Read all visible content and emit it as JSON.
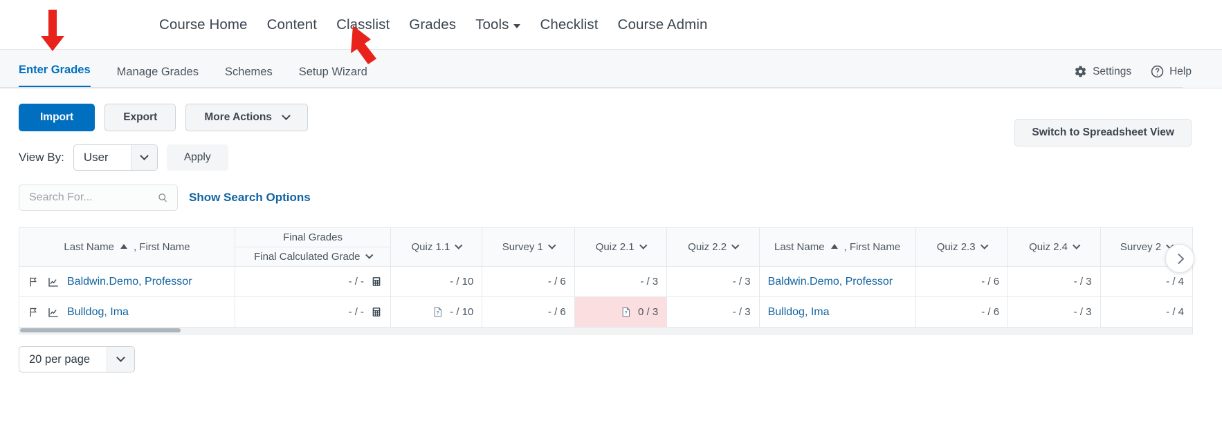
{
  "topnav": {
    "items": [
      {
        "label": "Course Home",
        "caret": false
      },
      {
        "label": "Content",
        "caret": false
      },
      {
        "label": "Classlist",
        "caret": false
      },
      {
        "label": "Grades",
        "caret": false
      },
      {
        "label": "Tools",
        "caret": true
      },
      {
        "label": "Checklist",
        "caret": false
      },
      {
        "label": "Course Admin",
        "caret": false
      }
    ]
  },
  "tabbar": {
    "tabs": [
      {
        "label": "Enter Grades",
        "active": true
      },
      {
        "label": "Manage Grades",
        "active": false
      },
      {
        "label": "Schemes",
        "active": false
      },
      {
        "label": "Setup Wizard",
        "active": false
      }
    ],
    "settings_label": "Settings",
    "help_label": "Help"
  },
  "toolbar": {
    "import_label": "Import",
    "export_label": "Export",
    "more_actions_label": "More Actions",
    "switch_view_label": "Switch to Spreadsheet View"
  },
  "viewby": {
    "label": "View By:",
    "value": "User",
    "apply_label": "Apply"
  },
  "search": {
    "placeholder": "Search For...",
    "value": "",
    "show_options_label": "Show Search Options"
  },
  "grid": {
    "group_header": "Final Grades",
    "columns": [
      {
        "key": "name1",
        "label": "Last Name",
        "suffix": ", First Name",
        "sort": true,
        "menu": false
      },
      {
        "key": "fcg",
        "label": "Final Calculated Grade",
        "suffix": "",
        "sort": false,
        "menu": true
      },
      {
        "key": "q11",
        "label": "Quiz 1.1",
        "suffix": "",
        "sort": false,
        "menu": true
      },
      {
        "key": "s1",
        "label": "Survey 1",
        "suffix": "",
        "sort": false,
        "menu": true
      },
      {
        "key": "q21",
        "label": "Quiz 2.1",
        "suffix": "",
        "sort": false,
        "menu": true
      },
      {
        "key": "q22",
        "label": "Quiz 2.2",
        "suffix": "",
        "sort": false,
        "menu": true
      },
      {
        "key": "name2",
        "label": "Last Name",
        "suffix": ", First Name",
        "sort": true,
        "menu": false
      },
      {
        "key": "q23",
        "label": "Quiz 2.3",
        "suffix": "",
        "sort": false,
        "menu": true
      },
      {
        "key": "q24",
        "label": "Quiz 2.4",
        "suffix": "",
        "sort": false,
        "menu": true
      },
      {
        "key": "s2",
        "label": "Survey 2",
        "suffix": "",
        "sort": false,
        "menu": true
      }
    ],
    "rows": [
      {
        "name": "Baldwin.Demo, Professor",
        "fcg": "- / -",
        "q11": "- / 10",
        "q11_icon": false,
        "s1": "- / 6",
        "q21": "- / 3",
        "q21_icon": false,
        "q21_flagged": false,
        "q22": "- / 3",
        "name2": "Baldwin.Demo, Professor",
        "q23": "- / 6",
        "q24": "- / 3",
        "s2": "- / 4"
      },
      {
        "name": "Bulldog, Ima",
        "fcg": "- / -",
        "q11": "- / 10",
        "q11_icon": true,
        "s1": "- / 6",
        "q21": "0 / 3",
        "q21_icon": true,
        "q21_flagged": true,
        "q22": "- / 3",
        "name2": "Bulldog, Ima",
        "q23": "- / 6",
        "q24": "- / 3",
        "s2": "- / 4"
      }
    ]
  },
  "pagination": {
    "per_page": "20 per page"
  },
  "colors": {
    "primary": "#006fbf",
    "link": "#1263a0",
    "danger_bg": "#fbdee0",
    "annotation": "#e8231b",
    "text": "#3c4650"
  }
}
